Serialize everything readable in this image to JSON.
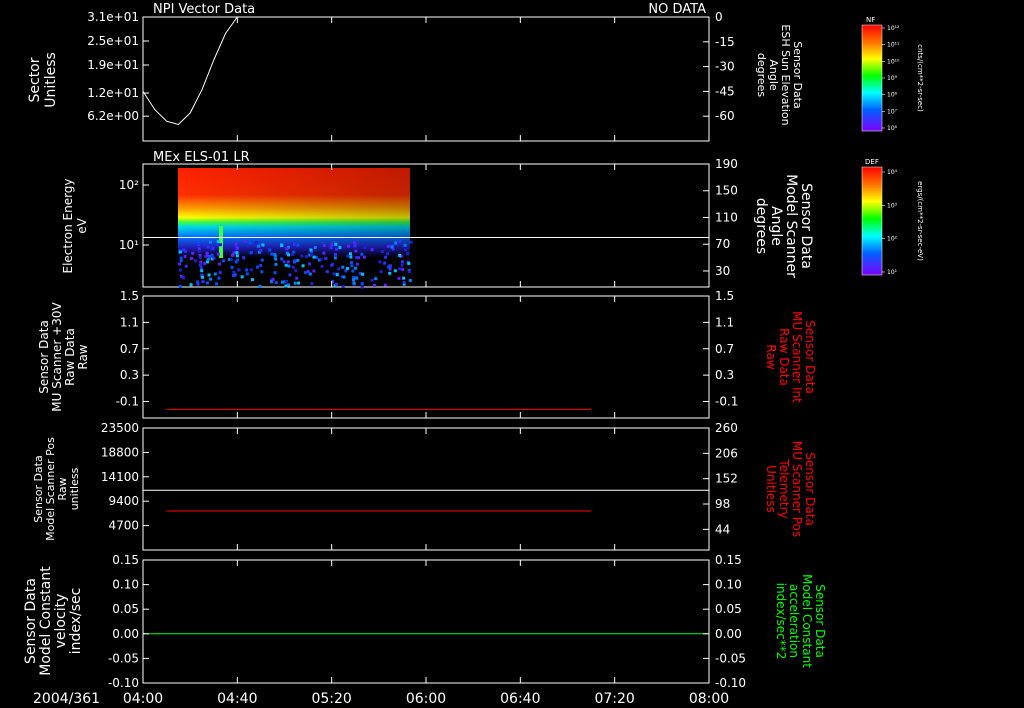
{
  "time_axis": {
    "date": "2004/361",
    "ticks": [
      "04:00",
      "04:40",
      "05:20",
      "06:00",
      "06:40",
      "07:20",
      "08:00"
    ],
    "start_min": 240,
    "end_min": 480
  },
  "panel1": {
    "title": "NPI Vector Data",
    "status": "NO DATA",
    "ylabel": [
      "Sector",
      "Unitless"
    ],
    "left_ticks": [
      {
        "value": 31,
        "label": "3.1e+01"
      },
      {
        "value": 25,
        "label": "2.5e+01"
      },
      {
        "value": 19,
        "label": "1.9e+01"
      },
      {
        "value": 12,
        "label": "1.2e+01"
      },
      {
        "value": 6.2,
        "label": "6.2e+00"
      }
    ],
    "left_range": [
      0,
      31
    ],
    "right_ticks": [
      "0",
      "-15",
      "-30",
      "-45",
      "-60"
    ],
    "right_values": [
      0,
      -15,
      -30,
      -45,
      -60
    ],
    "right_range": [
      -75,
      0
    ],
    "right_label": [
      "Sensor Data",
      "ESH Sun Elevation",
      "Angle",
      "degrees"
    ],
    "colorbar": {
      "name": "NF",
      "unit": "cnts/(cm**2-sr-sec)",
      "ticks": [
        "10¹²",
        "10¹¹",
        "10¹⁰",
        "10⁹",
        "10⁸",
        "10⁷",
        "10⁶"
      ]
    }
  },
  "panel2": {
    "title": "MEx ELS-01 LR",
    "ylabel": [
      "Electron Energy",
      "eV"
    ],
    "left_ticks": [
      {
        "value": 100,
        "label": "10²"
      },
      {
        "value": 10,
        "label": "10¹"
      }
    ],
    "left_range_log": [
      0.3,
      2.35
    ],
    "right_ticks": [
      "190",
      "150",
      "110",
      "70",
      "30"
    ],
    "right_values": [
      190,
      150,
      110,
      70,
      30
    ],
    "right_range": [
      6,
      190
    ],
    "right_label": [
      "Sensor Data",
      "Model Scanner",
      "Angle",
      "degrees"
    ],
    "colorbar": {
      "name": "DEF",
      "unit": "ergs/(cm**2-sr-sec-eV)",
      "ticks": [
        "10⁴",
        "10³",
        "10²",
        "10¹"
      ]
    }
  },
  "panel3": {
    "ylabel": [
      "Sensor Data",
      "MU Scanner +30V",
      "Raw Data",
      "Raw"
    ],
    "left_ticks": [
      "1.5",
      "1.1",
      "0.7",
      "0.3",
      "-0.1"
    ],
    "tick_values": [
      1.5,
      1.1,
      0.7,
      0.3,
      -0.1
    ],
    "range": [
      -0.35,
      1.5
    ],
    "right_ticks": [
      "1.5",
      "1.1",
      "0.7",
      "0.3",
      "-0.1"
    ],
    "right_label": [
      "Sensor Data",
      "MU Scanner Int",
      "Raw Data",
      "Raw"
    ]
  },
  "panel4": {
    "ylabel": [
      "Sensor Data",
      "Model Scanner Pos",
      "Raw",
      "unitless"
    ],
    "left_ticks": [
      "23500",
      "18800",
      "14100",
      "9400",
      "4700"
    ],
    "tick_values": [
      23500,
      18800,
      14100,
      9400,
      4700
    ],
    "range": [
      0,
      23500
    ],
    "right_ticks": [
      "260",
      "206",
      "152",
      "98",
      "44"
    ],
    "right_values": [
      260,
      206,
      152,
      98,
      44
    ],
    "right_range": [
      0,
      260
    ],
    "right_label": [
      "Sensor Data",
      "MU Scanner Pos",
      "Telemetry",
      "Unitless"
    ]
  },
  "panel5": {
    "ylabel": [
      "Sensor Data",
      "Model Constant",
      "velocity",
      "index/sec"
    ],
    "left_ticks": [
      "0.15",
      "0.10",
      "0.05",
      "0.00",
      "-0.05",
      "-0.10"
    ],
    "tick_values": [
      0.15,
      0.1,
      0.05,
      0.0,
      -0.05,
      -0.1
    ],
    "range": [
      -0.1,
      0.15
    ],
    "right_ticks": [
      "0.15",
      "0.10",
      "0.05",
      "0.00",
      "-0.05",
      "-0.10"
    ],
    "right_label": [
      "Sensor Data",
      "Model Constant",
      "acceleration",
      "index/sec**2"
    ]
  },
  "colors": {
    "background": "#000000",
    "axes": "#ffffff",
    "red_trace": "#ff0000",
    "green_trace": "#00ff00",
    "red_label": "#ff0000",
    "green_label": "#00ff00"
  },
  "chart_data": [
    {
      "type": "line",
      "title": "NPI Vector Data",
      "ylabel": "Sector Unitless",
      "series": [
        {
          "name": "Sensor Data ESH Sun Elevation Angle",
          "x": [
            240,
            245,
            250,
            255,
            260,
            265,
            270,
            275,
            280
          ],
          "y": [
            -45,
            -56,
            -63,
            -65,
            -58,
            -44,
            -26,
            -10,
            0
          ]
        }
      ]
    },
    {
      "type": "heatmap",
      "title": "MEx ELS-01 LR",
      "ylabel": "Electron Energy eV",
      "x_range": [
        255,
        395
      ],
      "energy_range_ev": [
        3,
        200
      ],
      "series": [
        {
          "name": "Sensor Data Model Scanner Angle",
          "x": [
            240,
            480
          ],
          "y": [
            80,
            80
          ]
        }
      ]
    },
    {
      "type": "line",
      "ylabel": "Sensor Data MU Scanner +30V Raw Data Raw",
      "series": [
        {
          "name": "Sensor Data MU Scanner Int Raw Data Raw",
          "x": [
            250,
            430
          ],
          "y": [
            -0.22,
            -0.22
          ]
        }
      ]
    },
    {
      "type": "line",
      "ylabel": "Sensor Data Model Scanner Pos Raw unitless",
      "series": [
        {
          "name": "Sensor Data Model Scanner Pos Raw unitless",
          "x": [
            240,
            480
          ],
          "y": [
            11500,
            11500
          ]
        },
        {
          "name": "Sensor Data MU Scanner Pos Telemetry Unitless",
          "x": [
            250,
            430
          ],
          "y": [
            83,
            83
          ]
        }
      ]
    },
    {
      "type": "line",
      "ylabel": "Sensor Data Model Constant velocity index/sec",
      "series": [
        {
          "name": "Sensor Data Model Constant velocity index/sec",
          "x": [
            240,
            480
          ],
          "y": [
            0.0,
            0.0
          ]
        }
      ]
    }
  ]
}
